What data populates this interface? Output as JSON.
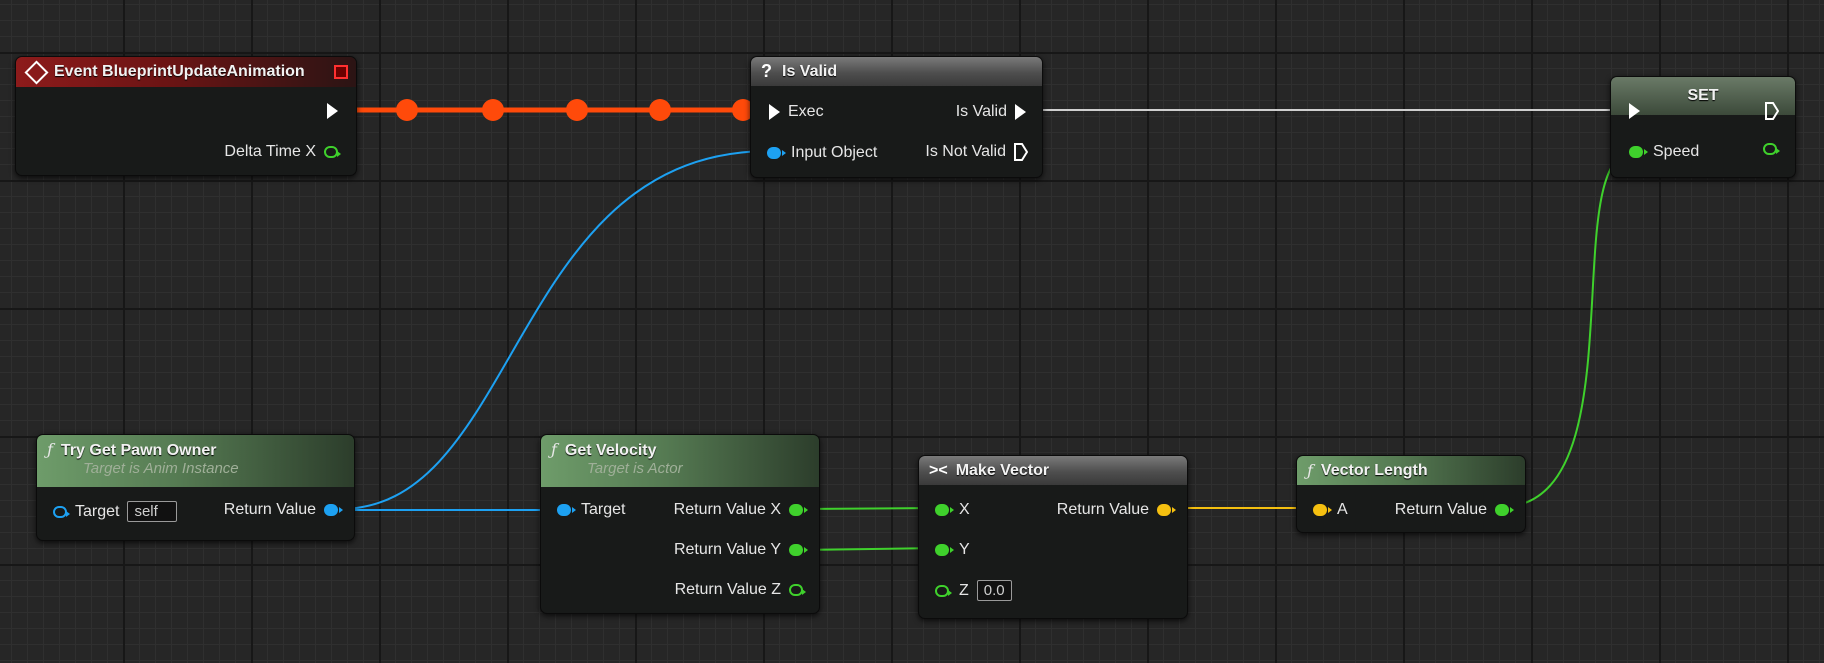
{
  "graph": {
    "nodes": {
      "event": {
        "title": "Event BlueprintUpdateAnimation",
        "icon": "event-diamond-icon",
        "outputs": {
          "delta": "Delta Time X"
        }
      },
      "is_valid": {
        "title": "Is Valid",
        "icon": "question-mark-icon",
        "inputs": {
          "exec": "Exec",
          "object": "Input Object"
        },
        "outputs": {
          "valid": "Is Valid",
          "not_valid": "Is Not Valid"
        }
      },
      "set": {
        "title": "SET",
        "inputs": {
          "speed": "Speed"
        }
      },
      "pawn_owner": {
        "title": "Try Get Pawn Owner",
        "subtitle": "Target is Anim Instance",
        "inputs": {
          "target": "Target",
          "target_default": "self"
        },
        "outputs": {
          "return": "Return Value"
        }
      },
      "velocity": {
        "title": "Get Velocity",
        "subtitle": "Target is Actor",
        "inputs": {
          "target": "Target"
        },
        "outputs": {
          "x": "Return Value X",
          "y": "Return Value Y",
          "z": "Return Value Z"
        }
      },
      "make_vector": {
        "title": "Make Vector",
        "inputs": {
          "x": "X",
          "y": "Y",
          "z": "Z",
          "z_default": "0.0"
        },
        "outputs": {
          "return": "Return Value"
        }
      },
      "vector_length": {
        "title": "Vector Length",
        "inputs": {
          "a": "A"
        },
        "outputs": {
          "return": "Return Value"
        }
      }
    },
    "colors": {
      "exec_wire": "#ff4a0a",
      "object_wire": "#1da1f2",
      "float_wire": "#3fd12c",
      "vector_wire": "#f5c010",
      "exec_white": "#d6d6d6"
    }
  }
}
